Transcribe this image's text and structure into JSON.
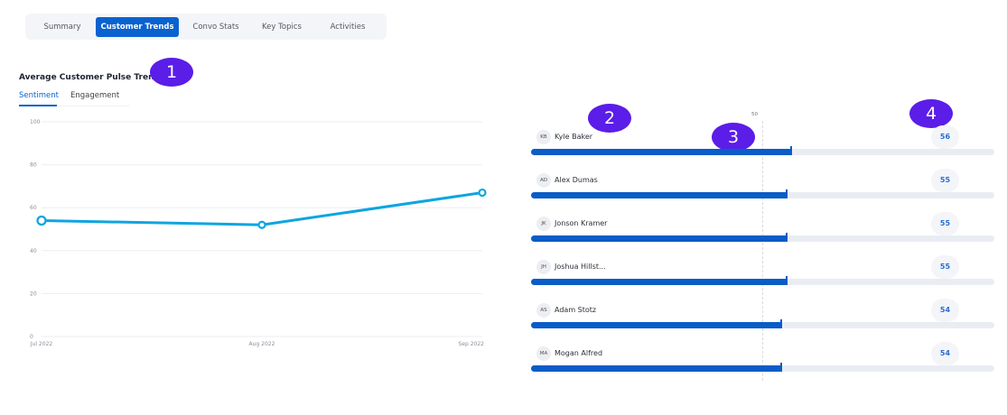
{
  "tabs": [
    {
      "label": "Summary",
      "active": false
    },
    {
      "label": "Customer Trends",
      "active": true
    },
    {
      "label": "Convo Stats",
      "active": false
    },
    {
      "label": "Key Topics",
      "active": false
    },
    {
      "label": "Activities",
      "active": false
    }
  ],
  "section": {
    "title": "Average Customer Pulse Trend",
    "subtabs": [
      {
        "label": "Sentiment",
        "active": true
      },
      {
        "label": "Engagement",
        "active": false
      }
    ]
  },
  "badges": [
    "1",
    "2",
    "3",
    "4"
  ],
  "colors": {
    "accent": "#0a62d0",
    "line": "#0ea5e0",
    "badge": "#5b1de8"
  },
  "chart_data": {
    "type": "line",
    "categories": [
      "Jul 2022",
      "Aug 2022",
      "Sep 2022"
    ],
    "series": [
      {
        "values": [
          54,
          52,
          67
        ]
      }
    ],
    "yticks": [
      "0",
      "20",
      "40",
      "60",
      "80",
      "100"
    ],
    "ylim": [
      0,
      100
    ],
    "grid": true,
    "xlabel": "",
    "ylabel": ""
  },
  "leaderboard": {
    "scale_label": "50",
    "reference_value": 50,
    "max_value": 100,
    "agents": [
      {
        "initials": "KB",
        "name": "Kyle Baker",
        "score": "56"
      },
      {
        "initials": "AD",
        "name": "Alex Dumas",
        "score": "55"
      },
      {
        "initials": "JK",
        "name": "Jonson Kramer",
        "score": "55"
      },
      {
        "initials": "JH",
        "name": "Joshua Hillst...",
        "score": "55"
      },
      {
        "initials": "AS",
        "name": "Adam Stotz",
        "score": "54"
      },
      {
        "initials": "MA",
        "name": "Mogan Alfred",
        "score": "54"
      }
    ]
  }
}
